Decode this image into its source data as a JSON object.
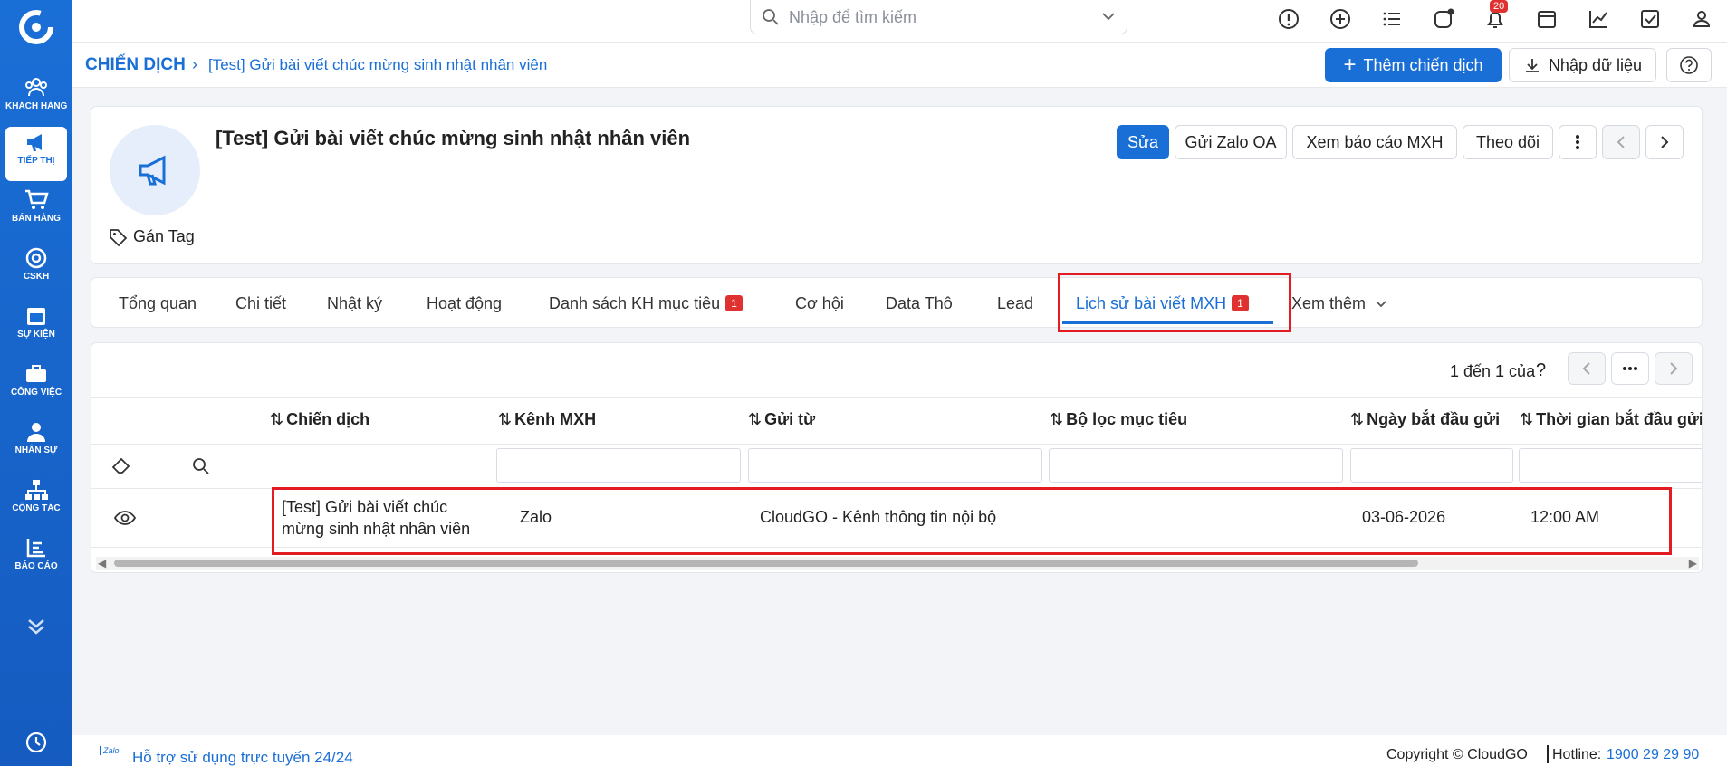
{
  "app": {
    "name": "CloudGO",
    "brand_color": "#1a6fd6",
    "alert_color": "#e31b23"
  },
  "sidebar": {
    "items": [
      {
        "label": "KHÁCH HÀNG",
        "icon": "customers-icon"
      },
      {
        "label": "TIẾP THỊ",
        "icon": "megaphone-icon",
        "active": true
      },
      {
        "label": "BÁN HÀNG",
        "icon": "cart-icon"
      },
      {
        "label": "CSKH",
        "icon": "lifebuoy-icon"
      },
      {
        "label": "SỰ KIỆN",
        "icon": "calendar-icon"
      },
      {
        "label": "CÔNG VIỆC",
        "icon": "briefcase-icon"
      },
      {
        "label": "NHÂN SỰ",
        "icon": "person-icon"
      },
      {
        "label": "CỘNG TÁC",
        "icon": "org-chart-icon"
      },
      {
        "label": "BÁO CÁO",
        "icon": "report-icon"
      }
    ]
  },
  "topbar": {
    "search_placeholder": "Nhập để tìm kiếm",
    "notification_count": "20"
  },
  "breadcrumb": {
    "module": "CHIẾN DỊCH",
    "record": "[Test] Gửi bài viết chúc mừng sinh nhật nhân viên"
  },
  "header_actions": {
    "add": "Thêm chiến dịch",
    "import": "Nhập dữ liệu"
  },
  "record": {
    "title": "[Test] Gửi bài viết chúc mừng sinh nhật nhân viên",
    "tag_label": "Gán Tag",
    "actions": {
      "edit": "Sửa",
      "send_zalo": "Gửi Zalo OA",
      "report": "Xem báo cáo MXH",
      "follow": "Theo dõi"
    }
  },
  "tabs": [
    {
      "label": "Tổng quan"
    },
    {
      "label": "Chi tiết"
    },
    {
      "label": "Nhật ký"
    },
    {
      "label": "Hoạt động"
    },
    {
      "label": "Danh sách KH mục tiêu",
      "count": "1"
    },
    {
      "label": "Cơ hội"
    },
    {
      "label": "Data Thô"
    },
    {
      "label": "Lead"
    },
    {
      "label": "Lịch sử bài viết MXH",
      "count": "1",
      "active": true
    },
    {
      "label": "Xem thêm"
    }
  ],
  "pagination": {
    "text": "1 đến 1 của",
    "unknown_total": "?"
  },
  "table": {
    "columns": [
      "Chiến dịch",
      "Kênh MXH",
      "Gửi từ",
      "Bộ lọc mục tiêu",
      "Ngày bắt đầu gửi",
      "Thời gian bắt đầu gửi"
    ],
    "rows": [
      {
        "campaign_line1": "[Test] Gửi bài viết chúc",
        "campaign_line2": "mừng sinh nhật nhân viên",
        "channel": "Zalo",
        "sent_from": "CloudGO - Kênh thông tin nội bộ",
        "target_filter": "",
        "start_date": "03-06-2026",
        "start_time": "12:00 AM"
      }
    ]
  },
  "footer": {
    "zalo_mark": "Zalo",
    "support": "Hỗ trợ sử dụng trực tuyến 24/24",
    "copyright": "Copyright © CloudGO",
    "hotline_label": "Hotline:",
    "hotline": "1900 29 29 90"
  }
}
